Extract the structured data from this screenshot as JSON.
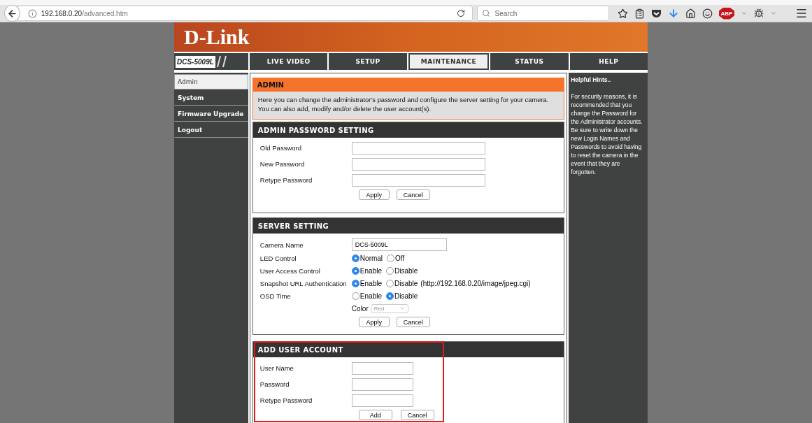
{
  "browser": {
    "url_host": "192.168.0.20",
    "url_path": "/advanced.htm",
    "search_placeholder": "Search",
    "adblock_label": "ABP"
  },
  "banner": {
    "logo": "D-Link"
  },
  "nav": {
    "model": "DCS-5009L",
    "tabs": [
      {
        "label": "LIVE VIDEO",
        "selected": false
      },
      {
        "label": "SETUP",
        "selected": false
      },
      {
        "label": "MAINTENANCE",
        "selected": true
      },
      {
        "label": "STATUS",
        "selected": false
      },
      {
        "label": "HELP",
        "selected": false
      }
    ]
  },
  "sidebar": {
    "items": [
      {
        "label": "Admin",
        "selected": true
      },
      {
        "label": "System",
        "selected": false
      },
      {
        "label": "Firmware Upgrade",
        "selected": false
      },
      {
        "label": "Logout",
        "selected": false
      }
    ]
  },
  "admin": {
    "title": "ADMIN",
    "description": "Here you can change the administrator's password and configure the server setting for your camera. You can also add, modify and/or delete the user account(s)."
  },
  "password_section": {
    "title": "ADMIN PASSWORD SETTING",
    "fields": [
      {
        "label": "Old Password"
      },
      {
        "label": "New Password"
      },
      {
        "label": "Retype Password"
      }
    ],
    "buttons": [
      "Apply",
      "Cancel"
    ]
  },
  "server_section": {
    "title": "SERVER SETTING",
    "rows": [
      {
        "kind": "text",
        "label": "Camera Name",
        "value": "DCS-5009L"
      },
      {
        "kind": "radio",
        "label": "LED Control",
        "options": [
          {
            "label": "Normal",
            "selected": true
          },
          {
            "label": "Off",
            "selected": false
          }
        ]
      },
      {
        "kind": "radio",
        "label": "User Access Control",
        "options": [
          {
            "label": "Enable",
            "selected": true
          },
          {
            "label": "Disable",
            "selected": false
          }
        ]
      },
      {
        "kind": "radio",
        "label": "Snapshot URL Authentication",
        "options": [
          {
            "label": "Enable",
            "selected": true
          },
          {
            "label": "Disable",
            "selected": false
          }
        ],
        "note": "(http://192.168.0.20/image/jpeg.cgi)"
      },
      {
        "kind": "radio",
        "label": "OSD Time",
        "options": [
          {
            "label": "Enable",
            "selected": false
          },
          {
            "label": "Disable",
            "selected": true
          }
        ]
      },
      {
        "kind": "select",
        "label": "Color",
        "value": "Red",
        "disabled": true
      }
    ],
    "buttons": [
      "Apply",
      "Cancel"
    ]
  },
  "add_user_section": {
    "title": "ADD USER ACCOUNT",
    "highlighted": true,
    "fields": [
      {
        "label": "User Name"
      },
      {
        "label": "Password"
      },
      {
        "label": "Retype Password"
      }
    ],
    "buttons": [
      "Add",
      "Cancel"
    ]
  },
  "hints": {
    "title": "Helpful Hints..",
    "text": "For security reasons, it is recommended that you change the Password for the Administrator accounts. Be sure to write down the new Login Names and Passwords to avoid having to reset the camera in the event that they are forgotten."
  }
}
